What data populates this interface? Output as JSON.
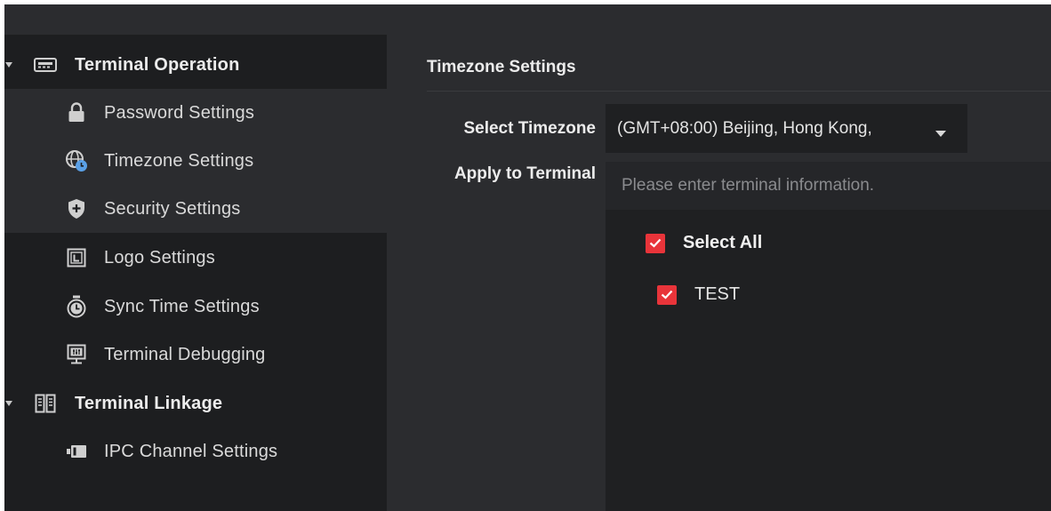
{
  "sidebar": {
    "groups": [
      {
        "label": "Terminal Operation",
        "icon": "terminal-device-icon",
        "items": [
          {
            "label": "Password Settings",
            "icon": "lock-icon"
          },
          {
            "label": "Timezone Settings",
            "icon": "globe-clock-icon",
            "selected": true
          },
          {
            "label": "Security Settings",
            "icon": "shield-plus-icon"
          },
          {
            "label": "Logo Settings",
            "icon": "logo-frame-icon"
          },
          {
            "label": "Sync Time Settings",
            "icon": "stopwatch-icon"
          },
          {
            "label": "Terminal Debugging",
            "icon": "debug-monitor-icon"
          }
        ]
      },
      {
        "label": "Terminal Linkage",
        "icon": "linkage-panels-icon",
        "items": [
          {
            "label": "IPC Channel Settings",
            "icon": "camera-channel-icon"
          }
        ]
      }
    ]
  },
  "main": {
    "title": "Timezone Settings",
    "timezone_label": "Select Timezone",
    "timezone_value": "(GMT+08:00) Beijing, Hong Kong,",
    "apply_label": "Apply to Terminal",
    "search_placeholder": "Please enter terminal information.",
    "select_all_label": "Select All",
    "terminals": [
      {
        "label": "TEST",
        "checked": true
      }
    ]
  },
  "colors": {
    "sidebar_bg": "#1d1e20",
    "main_bg": "#2b2c2f",
    "panel_bg": "#1f2022",
    "accent_red": "#e8343a",
    "text": "#e6e6e6"
  }
}
